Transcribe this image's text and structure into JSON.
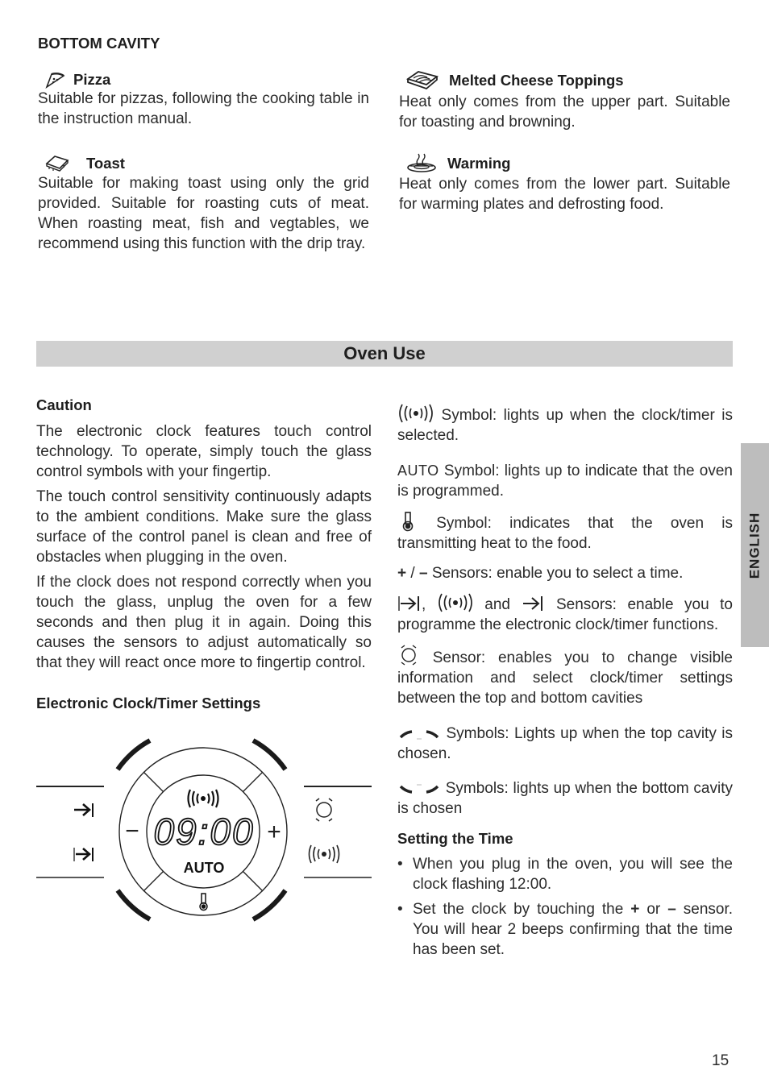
{
  "bottom_cavity": {
    "heading": "BOTTOM CAVITY",
    "functions": [
      {
        "icon": "pizza-icon",
        "title": "Pizza",
        "text": "Suitable for pizzas, following the cooking table in the instruction manual."
      },
      {
        "icon": "toast-icon",
        "title": "Toast",
        "text": "Suitable for making toast using only the grid provided. Suitable for roasting cuts of meat. When roasting meat, fish and vegtables, we recommend using this function with the drip tray."
      },
      {
        "icon": "melted-cheese-icon",
        "title": "Melted Cheese Toppings",
        "text": "Heat only comes from the upper part. Suitable for toasting and browning."
      },
      {
        "icon": "warming-icon",
        "title": "Warming",
        "text": "Heat only comes from the lower part. Suitable for warming plates and defrosting food."
      }
    ]
  },
  "section_title": "Oven Use",
  "caution": {
    "heading": "Caution",
    "paragraphs": [
      "The electronic clock features touch control technology. To operate, simply touch the glass control symbols with your fingertip.",
      "The touch control sensitivity continuously adapts to the ambient conditions. Make sure the glass surface of the control panel is clean and free of obstacles when plugging in the oven.",
      "If the clock does not respond correctly when you touch the glass, unplug the oven for a few seconds and then plug it in again. Doing this causes the sensors to adjust automatically so that they will react once more to fingertip control."
    ]
  },
  "clock_settings_heading": "Electronic Clock/Timer Settings",
  "control_panel": {
    "display_time": "09:00",
    "auto_label": "AUTO",
    "minus_label": "−",
    "plus_label": "+"
  },
  "symbols": [
    {
      "icon": "bell-signal-icon",
      "text": "Symbol: lights up when the clock/timer is selected."
    },
    {
      "icon_text": "AUTO",
      "text": "Symbol: lights up to indicate that the oven is programmed."
    },
    {
      "icon": "thermometer-icon",
      "text": "Symbol: indicates that the oven is transmitting heat to the food."
    },
    {
      "prefix_plus": "+",
      "prefix_sep": " / ",
      "prefix_minus": "–",
      "text": "Sensors: enable you to select a time."
    },
    {
      "sep1": ",",
      "sep2": "and",
      "text": "Sensors: enable you to programme the electronic clock/timer functions."
    },
    {
      "icon": "cavity-select-icon",
      "text": "Sensor: enables you to change visible information and select clock/timer settings between the top and bottom cavities"
    },
    {
      "icon": "top-cavity-icon",
      "text": "Symbols: Lights up when the top cavity is chosen."
    },
    {
      "icon": "bottom-cavity-icon",
      "text": "Symbols: lights up when the bottom cavity is chosen"
    }
  ],
  "setting_time": {
    "heading": "Setting the Time",
    "bullets": [
      {
        "text": "When you plug in the oven, you will see the clock flashing 12:00."
      },
      {
        "pre": "Set the clock by touching the",
        "plus": "+",
        "or": "or",
        "minus": "–",
        "post": "sensor. You will hear 2 beeps confirming that the time has been set."
      }
    ]
  },
  "language_tab": "ENGLISH",
  "page_number": "15"
}
